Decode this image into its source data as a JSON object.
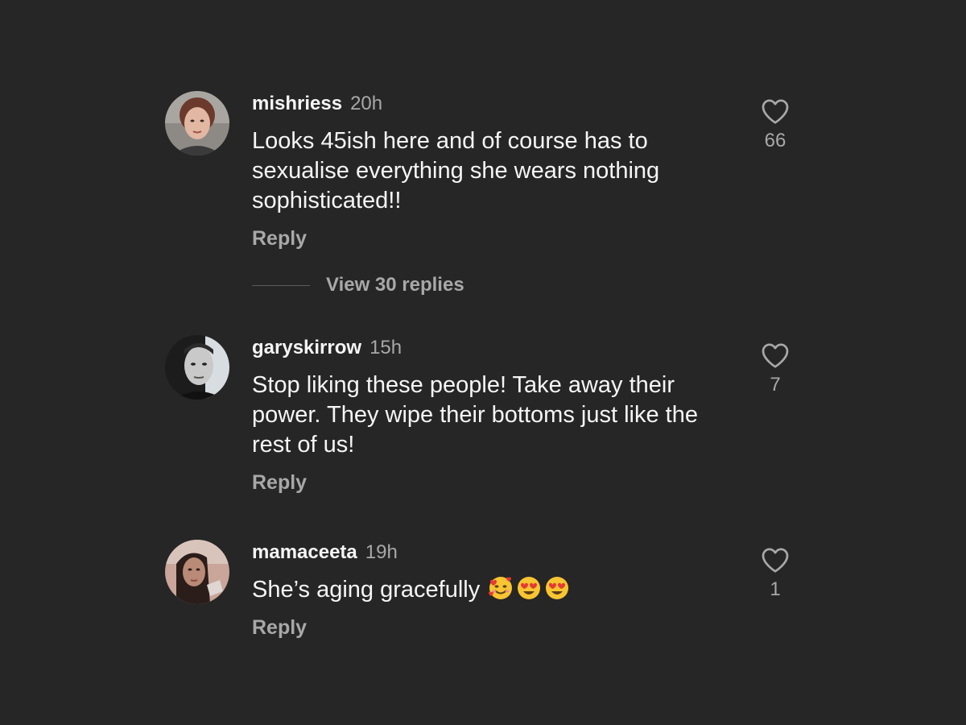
{
  "comments": [
    {
      "username": "mishriess",
      "time": "20h",
      "text": "Looks 45ish here and of course has to sexualise everything she wears nothing sophisticated!!",
      "reply_label": "Reply",
      "likes": "66",
      "view_replies_label": "View 30 replies"
    },
    {
      "username": "garyskirrow",
      "time": "15h",
      "text": "Stop liking these people! Take away their power. They wipe their bottoms just like the rest of us!",
      "reply_label": "Reply",
      "likes": "7"
    },
    {
      "username": "mamaceeta",
      "time": "19h",
      "text": "She’s aging gracefully",
      "emojis": [
        "smiling-face-with-hearts",
        "heart-eyes",
        "heart-eyes"
      ],
      "reply_label": "Reply",
      "likes": "1"
    }
  ],
  "colors": {
    "background": "#262626",
    "primary_text": "#f5f5f5",
    "secondary_text": "#a8a8a8"
  }
}
